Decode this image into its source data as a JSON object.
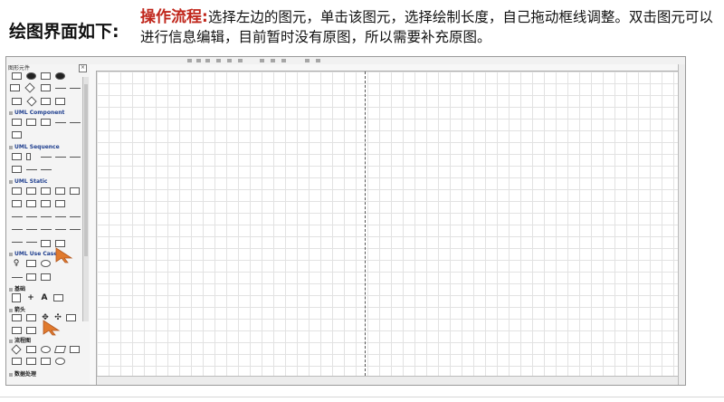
{
  "slide": {
    "title": "绘图界面如下:",
    "description_label": "操作流程:",
    "description_text": "选择左边的图元，单击该图元，选择绘制长度，自己拖动框线调整。双击图元可以进行信息编辑，目前暂时没有原图，所以需要补充原图。"
  },
  "palette": {
    "title": "图形元件",
    "close": "×",
    "sections": [
      {
        "label": "UML Component"
      },
      {
        "label": "UML Sequence"
      },
      {
        "label": "UML Static"
      },
      {
        "label": "UML Use Case"
      },
      {
        "label": "基础"
      },
      {
        "label": "箭头"
      },
      {
        "label": "流程图"
      },
      {
        "label": "数据处理"
      }
    ],
    "text_tool": "A"
  },
  "colors": {
    "highlight": "#c0271c",
    "cursor": "#e07a2e"
  }
}
